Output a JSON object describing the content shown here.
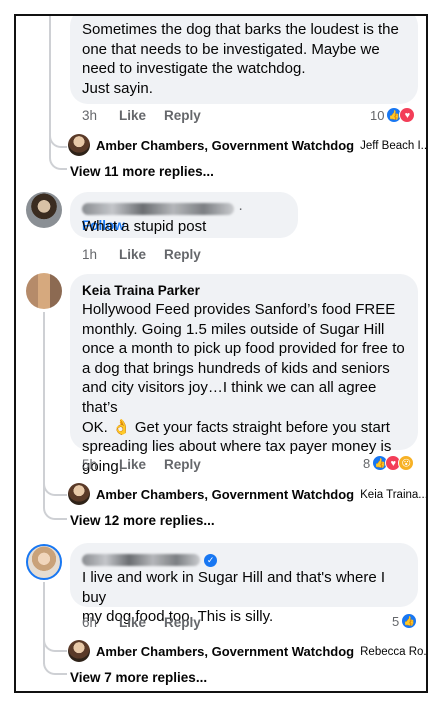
{
  "comments": [
    {
      "text": "Sometimes the dog that barks the loudest is the\none that needs to be investigated. Maybe we\nneed to investigate the watchdog.\nJust sayin.",
      "time": "3h",
      "like": "Like",
      "reply": "Reply",
      "reaction_count": "10",
      "reply_preview": {
        "name": "Amber Chambers, Government Watchdog",
        "snippet": "Jeff Beach I..."
      },
      "more_replies": "View 11 more replies..."
    },
    {
      "follow": "Follow",
      "text": "What a stupid post",
      "time": "1h",
      "like": "Like",
      "reply": "Reply"
    },
    {
      "author": "Keia Traina Parker",
      "text": "Hollywood Feed provides Sanford’s food FREE\nmonthly. Going 1.5 miles outside of Sugar Hill\nonce a month to pick up food provided for free to\na dog that brings hundreds of kids and seniors\nand city visitors joy…I think we can all agree that’s\nOK. 👌 Get your facts straight before you start\nspreading lies about where tax payer money is\ngoing.",
      "time": "5h",
      "like": "Like",
      "reply": "Reply",
      "reaction_count": "8",
      "reply_preview": {
        "name": "Amber Chambers, Government Watchdog",
        "snippet": "Keia Traina..."
      },
      "more_replies": "View 12 more replies..."
    },
    {
      "text": "I live and work in Sugar Hill and that's where I buy\nmy dog food too. This is silly.",
      "time": "6h",
      "like": "Like",
      "reply": "Reply",
      "reaction_count": "5",
      "reply_preview": {
        "name": "Amber Chambers, Government Watchdog",
        "snippet": "Rebecca Ro..."
      },
      "more_replies": "View 7 more replies..."
    }
  ],
  "colors": {
    "like": "#1877f2",
    "love": "#f33e58",
    "wow": "#f7b125",
    "bubble": "#f0f2f5",
    "muted": "#65676b"
  }
}
